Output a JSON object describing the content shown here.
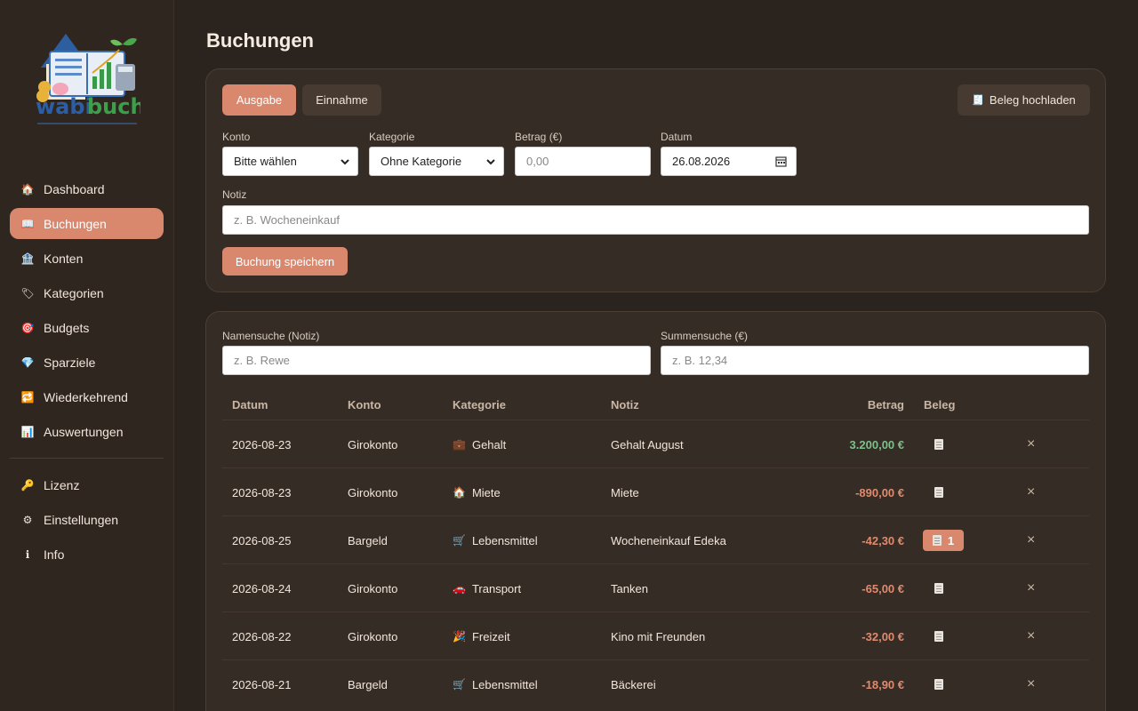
{
  "app": {
    "logo_text": "wabibuch"
  },
  "sidebar": {
    "items": [
      {
        "label": "Dashboard",
        "icon": "house-icon"
      },
      {
        "label": "Buchungen",
        "icon": "book-icon",
        "active": true
      },
      {
        "label": "Konten",
        "icon": "bank-icon"
      },
      {
        "label": "Kategorien",
        "icon": "tag-icon"
      },
      {
        "label": "Budgets",
        "icon": "target-icon"
      },
      {
        "label": "Sparziele",
        "icon": "diamond-icon"
      },
      {
        "label": "Wiederkehrend",
        "icon": "repeat-icon"
      },
      {
        "label": "Auswertungen",
        "icon": "chart-icon"
      }
    ],
    "bottom_items": [
      {
        "label": "Lizenz",
        "icon": "key-icon"
      },
      {
        "label": "Einstellungen",
        "icon": "gear-icon"
      },
      {
        "label": "Info",
        "icon": "info-icon"
      }
    ]
  },
  "page": {
    "title": "Buchungen"
  },
  "form": {
    "type_expense": "Ausgabe",
    "type_income": "Einnahme",
    "upload_button": "Beleg hochladen",
    "konto_label": "Konto",
    "konto_value": "Bitte wählen",
    "kategorie_label": "Kategorie",
    "kategorie_value": "Ohne Kategorie",
    "betrag_label": "Betrag (€)",
    "betrag_placeholder": "0,00",
    "datum_label": "Datum",
    "datum_value": "26.08.2026",
    "notiz_label": "Notiz",
    "notiz_placeholder": "z. B. Wocheneinkauf",
    "save_button": "Buchung speichern"
  },
  "search": {
    "name_label": "Namensuche (Notiz)",
    "name_placeholder": "z. B. Rewe",
    "sum_label": "Summensuche (€)",
    "sum_placeholder": "z. B. 12,34"
  },
  "table": {
    "headers": {
      "datum": "Datum",
      "konto": "Konto",
      "kategorie": "Kategorie",
      "notiz": "Notiz",
      "betrag": "Betrag",
      "beleg": "Beleg"
    },
    "rows": [
      {
        "datum": "2026-08-23",
        "konto": "Girokonto",
        "kategorie": "Gehalt",
        "kategorie_icon": "💼",
        "notiz": "Gehalt August",
        "betrag": "3.200,00 €",
        "positive": true,
        "beleg_count": ""
      },
      {
        "datum": "2026-08-23",
        "konto": "Girokonto",
        "kategorie": "Miete",
        "kategorie_icon": "🏠",
        "notiz": "Miete",
        "betrag": "-890,00 €",
        "positive": false,
        "beleg_count": ""
      },
      {
        "datum": "2026-08-25",
        "konto": "Bargeld",
        "kategorie": "Lebensmittel",
        "kategorie_icon": "🛒",
        "notiz": "Wocheneinkauf Edeka",
        "betrag": "-42,30 €",
        "positive": false,
        "beleg_count": "1"
      },
      {
        "datum": "2026-08-24",
        "konto": "Girokonto",
        "kategorie": "Transport",
        "kategorie_icon": "🚗",
        "notiz": "Tanken",
        "betrag": "-65,00 €",
        "positive": false,
        "beleg_count": ""
      },
      {
        "datum": "2026-08-22",
        "konto": "Girokonto",
        "kategorie": "Freizeit",
        "kategorie_icon": "🎉",
        "notiz": "Kino mit Freunden",
        "betrag": "-32,00 €",
        "positive": false,
        "beleg_count": ""
      },
      {
        "datum": "2026-08-21",
        "konto": "Bargeld",
        "kategorie": "Lebensmittel",
        "kategorie_icon": "🛒",
        "notiz": "Bäckerei",
        "betrag": "-18,90 €",
        "positive": false,
        "beleg_count": ""
      }
    ],
    "delete_symbol": "×"
  },
  "colors": {
    "accent": "#d9876d",
    "positive": "#7cc08b",
    "negative": "#e08a6e",
    "background": "#2a231e"
  }
}
